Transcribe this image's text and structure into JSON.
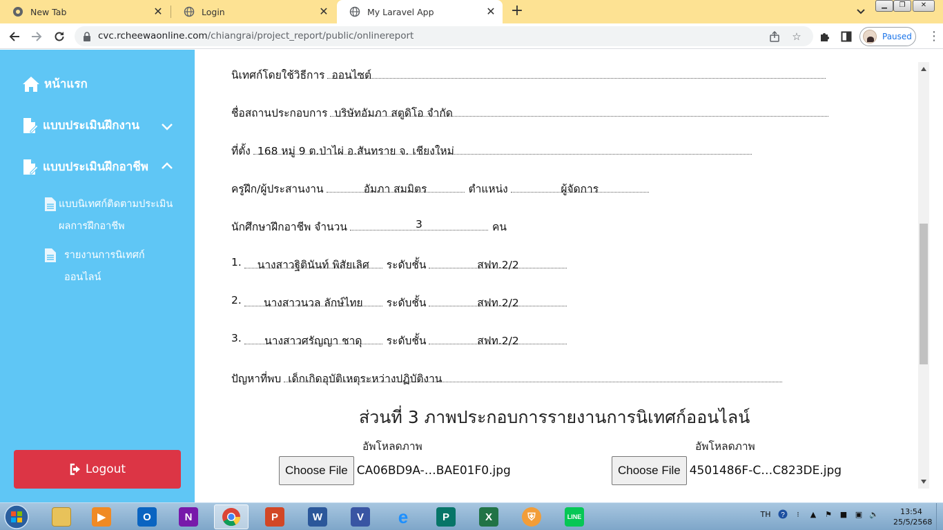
{
  "browser": {
    "tabs": [
      {
        "title": "New Tab",
        "active": false
      },
      {
        "title": "Login",
        "active": false
      },
      {
        "title": "My Laravel App",
        "active": true
      }
    ],
    "url_host": "cvc.rcheewaonline.com",
    "url_path": "/chiangrai/project_report/public/onlinereport",
    "profile_status": "Paused"
  },
  "sidebar": {
    "home": "หน้าแรก",
    "menu1": "แบบประเมินฝึกงาน",
    "menu2": "แบบประเมินฝึกอาชีพ",
    "sub1_line1": "แบบนิเทศก์ติดตามประเมิน",
    "sub1_line2": "ผลการฝึกอาชีพ",
    "sub2_line1": "รายงานการนิเทศก์",
    "sub2_line2": "ออนไลน์",
    "logout": "Logout"
  },
  "form": {
    "method_label": "นิเทศก์โดยใช้วิธีการ",
    "method_value": "ออนไซต์",
    "company_label": "ชื่อสถานประกอบการ",
    "company_value": "บริษัทอัมภา สตูดิโอ จำกัด",
    "address_label": "ที่ตั้ง",
    "address_value": "168 หมู่ 9 ต.ป่าไผ่  อ.สันทราย จ. เชียงใหม่",
    "trainer_label": "ครูฝึก/ผู้ประสานงาน",
    "trainer_value": "อัมภา  สมมิตร",
    "position_label": "ตำแหน่ง",
    "position_value": "ผู้จัดการ",
    "students_label": "นักศึกษาฝึกอาชีพ จำนวน",
    "students_count": "3",
    "students_unit": "คน",
    "level_label": "ระดับชั้น",
    "students": [
      {
        "no": "1.",
        "name": "นางสาวฐิตินันท์  พิสัยเลิศ",
        "level": "สฟท.2/2"
      },
      {
        "no": "2.",
        "name": "นางสาวนวล  ลักษ์ไทย",
        "level": "สฟท.2/2"
      },
      {
        "no": "3.",
        "name": "นางสาวศรัญญา  ชาดุ",
        "level": "สฟท.2/2"
      }
    ],
    "problem_label": "ปัญหาที่พบ",
    "problem_value": "เด็กเกิดอุบัติเหตุระหว่างปฏิบัติงาน"
  },
  "section3": {
    "title": "ส่วนที่ 3 ภาพประกอบการรายงานการนิเทศก์ออนไลน์",
    "uploads": [
      {
        "label": "อัพโหลดภาพ",
        "button": "Choose File",
        "filename": "CA06BD9A-…BAE01F0.jpg"
      },
      {
        "label": "อัพโหลดภาพ",
        "button": "Choose File",
        "filename": "4501486F-C…C823DE.jpg"
      }
    ]
  },
  "taskbar": {
    "lang": "TH",
    "time": "13:54",
    "date": "25/5/2568"
  }
}
